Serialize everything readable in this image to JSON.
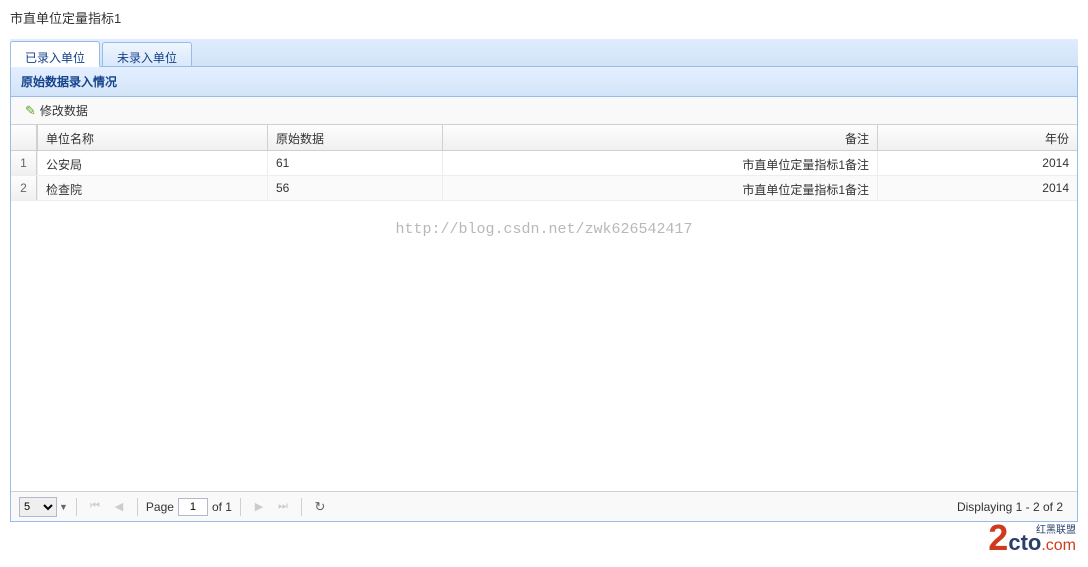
{
  "page": {
    "title": "市直单位定量指标1"
  },
  "tabs": [
    {
      "label": "已录入单位",
      "active": true
    },
    {
      "label": "未录入单位",
      "active": false
    }
  ],
  "panel": {
    "title": "原始数据录入情况"
  },
  "toolbar": {
    "edit_label": "修改数据"
  },
  "grid": {
    "headers": {
      "unit": "单位名称",
      "data": "原始数据",
      "remark": "备注",
      "year": "年份"
    },
    "rows": [
      {
        "num": "1",
        "unit": "公安局",
        "data": "61",
        "remark": "市直单位定量指标1备注",
        "year": "2014"
      },
      {
        "num": "2",
        "unit": "检查院",
        "data": "56",
        "remark": "市直单位定量指标1备注",
        "year": "2014"
      }
    ]
  },
  "watermark": "http://blog.csdn.net/zwk626542417",
  "paging": {
    "page_size": "5",
    "page_label_prefix": "Page",
    "current_page": "1",
    "page_label_suffix": "of 1",
    "display_text": "Displaying 1 - 2 of 2"
  },
  "brand": {
    "num": "2",
    "cto": "cto",
    "com": ".com",
    "cn": "红黑联盟"
  }
}
